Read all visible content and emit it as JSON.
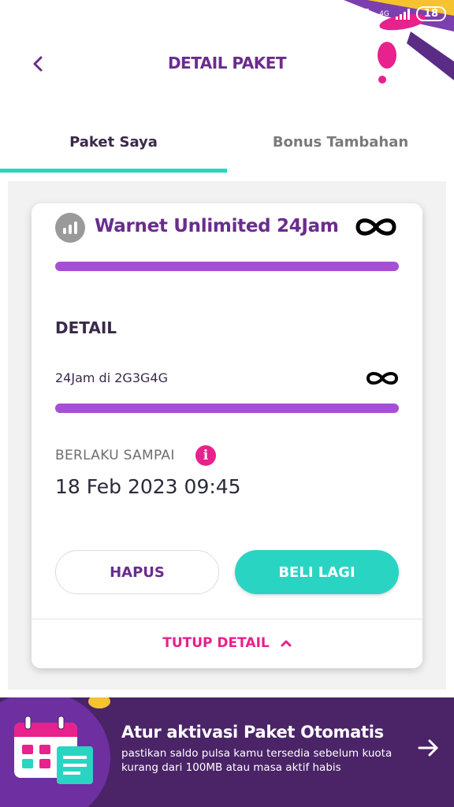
{
  "status_bar": {
    "network": "4G",
    "battery": "18"
  },
  "header": {
    "title": "DETAIL PAKET"
  },
  "tabs": [
    {
      "label": "Paket Saya",
      "active": true
    },
    {
      "label": "Bonus Tambahan",
      "active": false
    }
  ],
  "package": {
    "name": "Warnet Unlimited 24Jam",
    "quota_progress": 1.0,
    "detail_label": "DETAIL",
    "detail_items": [
      {
        "label": "24Jam di 2G3G4G",
        "progress": 1.0
      }
    ],
    "valid_label": "BERLAKU SAMPAI",
    "valid_until": "18 Feb 2023 09:45",
    "delete_label": "HAPUS",
    "buy_again_label": "BELI LAGI",
    "close_detail_label": "TUTUP DETAIL"
  },
  "banner": {
    "title": "Atur aktivasi Paket Otomatis",
    "text": "pastikan saldo pulsa kamu tersedia sebelum kuota kurang dari 100MB atau masa aktif habis"
  },
  "colors": {
    "primary_purple": "#6a2c8e",
    "progress_bar": "#a64fd6",
    "teal": "#2ad4c2",
    "pink": "#e8218c",
    "banner_bg": "#4a2467"
  }
}
